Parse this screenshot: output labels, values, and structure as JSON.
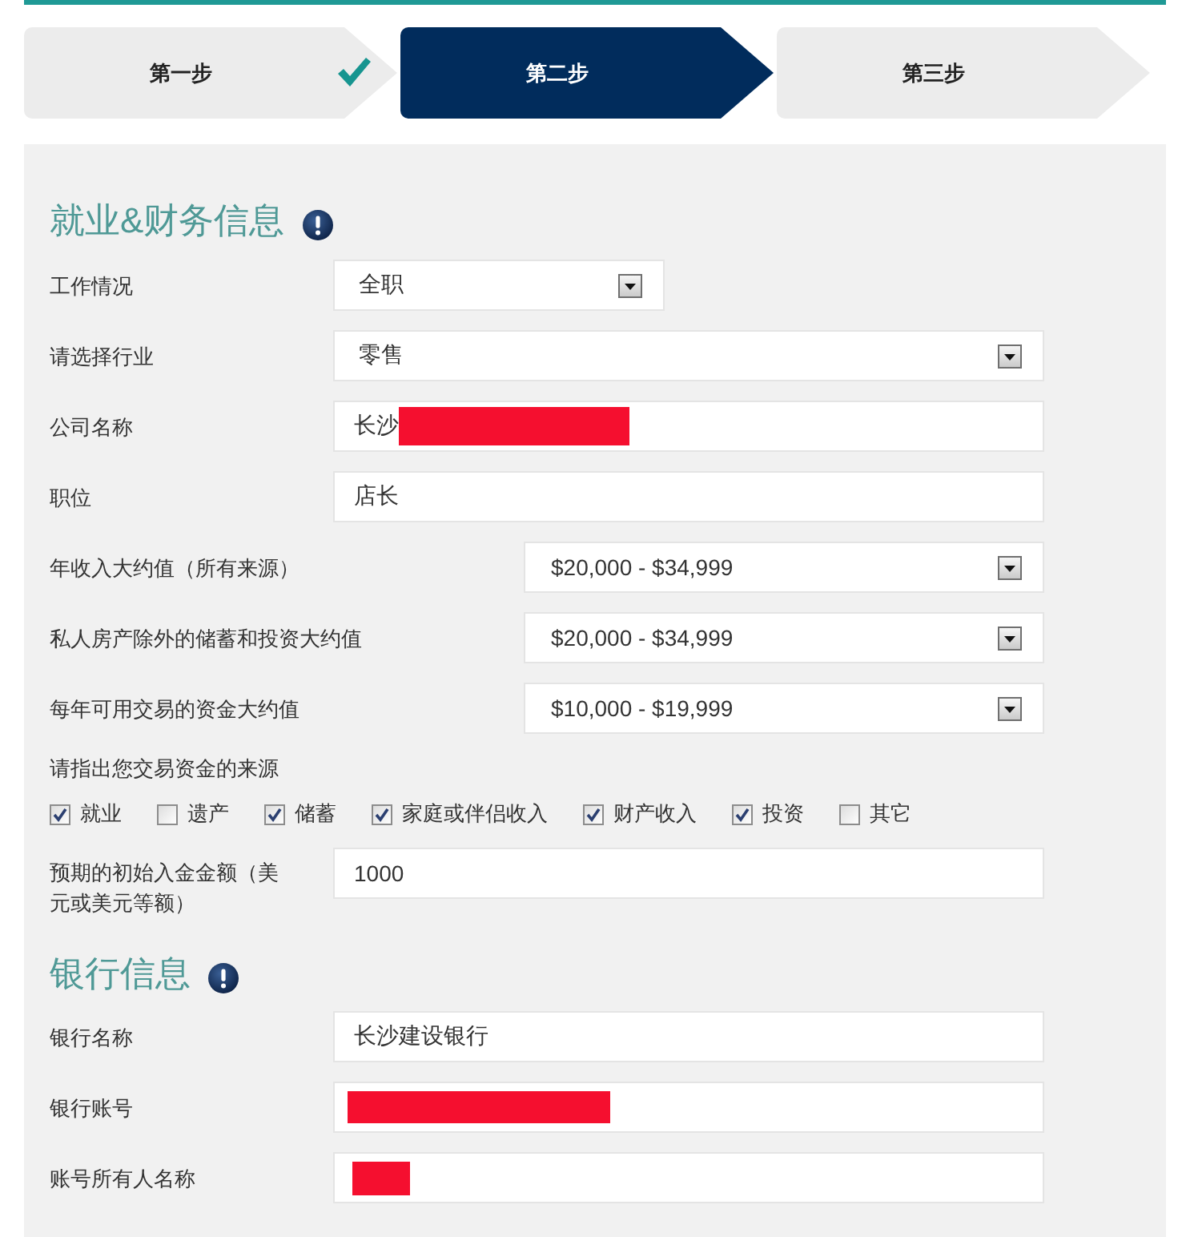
{
  "steps": [
    {
      "label": "第一步",
      "selected": false,
      "completed": true
    },
    {
      "label": "第二步",
      "selected": true,
      "completed": false
    },
    {
      "label": "第三步",
      "selected": false,
      "completed": false
    }
  ],
  "employment": {
    "title": "就业&财务信息",
    "fields": [
      {
        "kind": "select",
        "label": "工作情况",
        "value": "全职",
        "redacted": false
      },
      {
        "kind": "select",
        "label": "请选择行业",
        "value": "零售",
        "redacted": false
      },
      {
        "kind": "input",
        "label": "公司名称",
        "value": "长沙",
        "redacted": true
      },
      {
        "kind": "input",
        "label": "职位",
        "value": "店长",
        "redacted": false
      }
    ],
    "estimates": [
      {
        "kind": "select",
        "label": "年收入大约值（所有来源）",
        "value": "$20,000 - $34,999",
        "redacted": false
      },
      {
        "kind": "select",
        "label": "私人房产除外的储蓄和投资大约值",
        "value": "$20,000 - $34,999",
        "redacted": false
      },
      {
        "kind": "select",
        "label": "每年可用交易的资金大约值",
        "value": "$10,000 - $19,999",
        "redacted": false
      }
    ],
    "sources": {
      "label": "请指出您交易资金的来源",
      "options": [
        {
          "label": "就业",
          "checked": true
        },
        {
          "label": "遗产",
          "checked": false
        },
        {
          "label": "储蓄",
          "checked": true
        },
        {
          "label": "家庭或伴侣收入",
          "checked": true
        },
        {
          "label": "财产收入",
          "checked": true
        },
        {
          "label": "投资",
          "checked": true
        },
        {
          "label": "其它",
          "checked": false
        }
      ]
    },
    "initial_deposit": {
      "kind": "input",
      "label": "预期的初始入金金额（美元或美元等额）",
      "value": "1000",
      "redacted": false
    }
  },
  "bank": {
    "title": "银行信息",
    "fields": [
      {
        "kind": "input",
        "label": "银行名称",
        "value": "长沙建设银行",
        "redacted": false
      },
      {
        "kind": "input",
        "label": "银行账号",
        "redacted": true
      },
      {
        "kind": "input",
        "label": "账号所有人名称",
        "redacted": true
      }
    ]
  }
}
